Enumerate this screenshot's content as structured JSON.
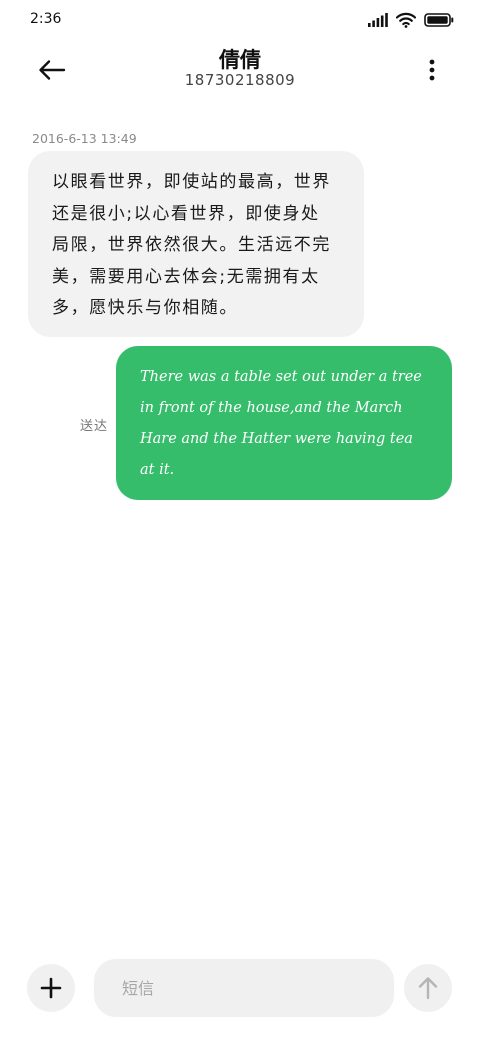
{
  "status_bar": {
    "time": "2:36",
    "icons": [
      "signal-icon",
      "wifi-icon",
      "battery-icon"
    ]
  },
  "header": {
    "title": "倩倩",
    "subtitle": "18730218809",
    "icons": [
      "back-arrow-icon",
      "more-vert-icon"
    ]
  },
  "conversation": {
    "timestamp": "2016-6-13 13:49",
    "incoming_message": "以眼看世界，即使站的最高，世界还是很小;以心看世界，即使身处局限，世界依然很大。生活远不完美，需要用心去体会;无需拥有太多，愿快乐与你相随。",
    "outgoing_message": "There was a table set out under a tree in front of the house,and the March Hare and the Hatter were having tea at it.",
    "outgoing_status": "送达"
  },
  "composer": {
    "placeholder": "短信",
    "value": "",
    "icons": [
      "plus-icon",
      "send-arrow-icon"
    ]
  },
  "colors": {
    "outgoing_bubble": "#35bd6b",
    "incoming_bubble": "#f2f2f2",
    "composer_bg": "#f0f0f0"
  }
}
